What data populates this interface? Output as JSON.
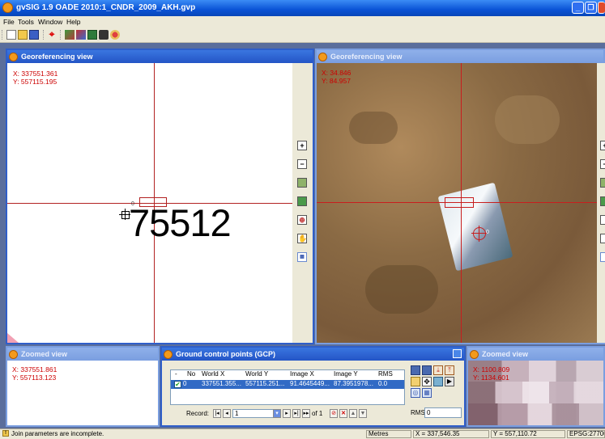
{
  "window": {
    "title": "gvSIG 1.9 OADE 2010:1_CNDR_2009_AKH.gvp",
    "minimize": "_",
    "restore": "❐",
    "close": "✕"
  },
  "menu": [
    "File",
    "Tools",
    "Window",
    "Help"
  ],
  "toolbar": {
    "icons": [
      "new-project-icon",
      "open-project-icon",
      "save-project-icon",
      "add-gcp-icon",
      "layers-icon",
      "georef-icon",
      "table-icon",
      "tools-icon",
      "pointer-icon"
    ]
  },
  "left_view": {
    "title": "Georeferencing view",
    "x": "X: 337551.361",
    "y": "Y: 557115.195",
    "point_number": "0",
    "label": "75512"
  },
  "right_view": {
    "title": "Georeferencing view",
    "x": "X: 34.846",
    "y": "Y: 84.957",
    "point_number": "0"
  },
  "side_tools": [
    "zoom-in-icon",
    "zoom-out-icon",
    "zoom-full-icon",
    "layers-icon",
    "zoom-rect-icon",
    "pan-icon",
    "grid-icon"
  ],
  "zoom_left": {
    "title": "Zoomed view",
    "x": "X: 337551.861",
    "y": "Y: 557113.123"
  },
  "zoom_right": {
    "title": "Zoomed view",
    "x": "X: 1100.809",
    "y": "Y: 1134.601"
  },
  "gcp": {
    "title": "Ground control points (GCP)",
    "headers": [
      "-",
      "No",
      "World X",
      "World Y",
      "Image X",
      "Image Y",
      "RMS"
    ],
    "row": {
      "checked": true,
      "no": "0",
      "world_x": "337551.355...",
      "world_y": "557115.251...",
      "image_x": "91.4645449...",
      "image_y": "87.3951978...",
      "rms": "0.0"
    },
    "record_label": "Record:",
    "record_value": "1",
    "record_of": "of 1",
    "rms_label": "RMS:",
    "rms_value": "0"
  },
  "status": {
    "message": "Join parameters are incomplete.",
    "units": "Metres",
    "x": "X = 337,546.35",
    "y": "Y = 557,110.72",
    "epsg": "EPSG:27700"
  }
}
